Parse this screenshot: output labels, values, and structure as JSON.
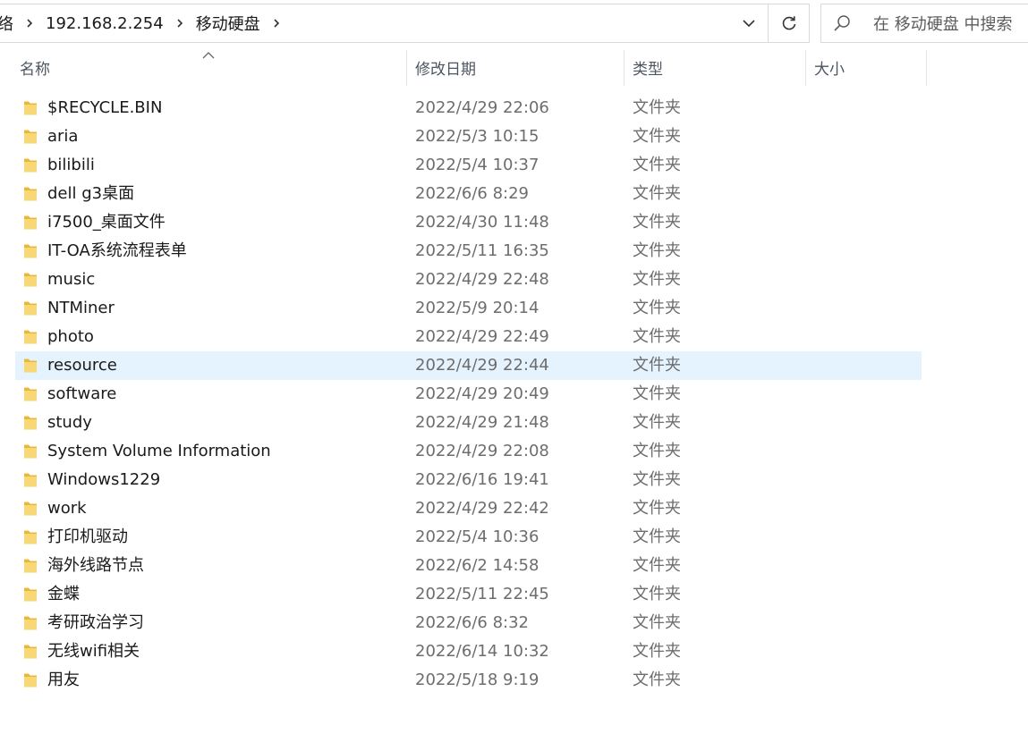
{
  "address": {
    "crumbs": [
      "络",
      "192.168.2.254",
      "移动硬盘"
    ]
  },
  "search": {
    "placeholder": "在 移动硬盘 中搜索"
  },
  "columns": {
    "name": "名称",
    "modified": "修改日期",
    "type": "类型",
    "size": "大小"
  },
  "files": [
    {
      "name": "$RECYCLE.BIN",
      "modified": "2022/4/29 22:06",
      "type": "文件夹",
      "size": ""
    },
    {
      "name": "aria",
      "modified": "2022/5/3 10:15",
      "type": "文件夹",
      "size": ""
    },
    {
      "name": "bilibili",
      "modified": "2022/5/4 10:37",
      "type": "文件夹",
      "size": ""
    },
    {
      "name": "dell g3桌面",
      "modified": "2022/6/6 8:29",
      "type": "文件夹",
      "size": ""
    },
    {
      "name": "i7500_桌面文件",
      "modified": "2022/4/30 11:48",
      "type": "文件夹",
      "size": ""
    },
    {
      "name": "IT-OA系统流程表单",
      "modified": "2022/5/11 16:35",
      "type": "文件夹",
      "size": ""
    },
    {
      "name": "music",
      "modified": "2022/4/29 22:48",
      "type": "文件夹",
      "size": ""
    },
    {
      "name": "NTMiner",
      "modified": "2022/5/9 20:14",
      "type": "文件夹",
      "size": ""
    },
    {
      "name": "photo",
      "modified": "2022/4/29 22:49",
      "type": "文件夹",
      "size": ""
    },
    {
      "name": "resource",
      "modified": "2022/4/29 22:44",
      "type": "文件夹",
      "size": "",
      "selected": true
    },
    {
      "name": "software",
      "modified": "2022/4/29 20:49",
      "type": "文件夹",
      "size": ""
    },
    {
      "name": "study",
      "modified": "2022/4/29 21:48",
      "type": "文件夹",
      "size": ""
    },
    {
      "name": "System Volume Information",
      "modified": "2022/4/29 22:08",
      "type": "文件夹",
      "size": ""
    },
    {
      "name": "Windows1229",
      "modified": "2022/6/16 19:41",
      "type": "文件夹",
      "size": ""
    },
    {
      "name": "work",
      "modified": "2022/4/29 22:42",
      "type": "文件夹",
      "size": ""
    },
    {
      "name": "打印机驱动",
      "modified": "2022/5/4 10:36",
      "type": "文件夹",
      "size": ""
    },
    {
      "name": "海外线路节点",
      "modified": "2022/6/2 14:58",
      "type": "文件夹",
      "size": ""
    },
    {
      "name": "金蝶",
      "modified": "2022/5/11 22:45",
      "type": "文件夹",
      "size": ""
    },
    {
      "name": "考研政治学习",
      "modified": "2022/6/6 8:32",
      "type": "文件夹",
      "size": ""
    },
    {
      "name": "无线wifi相关",
      "modified": "2022/6/14 10:32",
      "type": "文件夹",
      "size": ""
    },
    {
      "name": "用友",
      "modified": "2022/5/18 9:19",
      "type": "文件夹",
      "size": ""
    }
  ],
  "icons": {
    "folder": "folder-icon",
    "chevron": "chevron-right-icon",
    "dropdown": "chevron-down-icon",
    "refresh": "refresh-icon",
    "search": "search-icon",
    "sort": "sort-up-icon"
  },
  "colors": {
    "selected_row": "#e5f3ff",
    "folder": "#f8d775"
  }
}
